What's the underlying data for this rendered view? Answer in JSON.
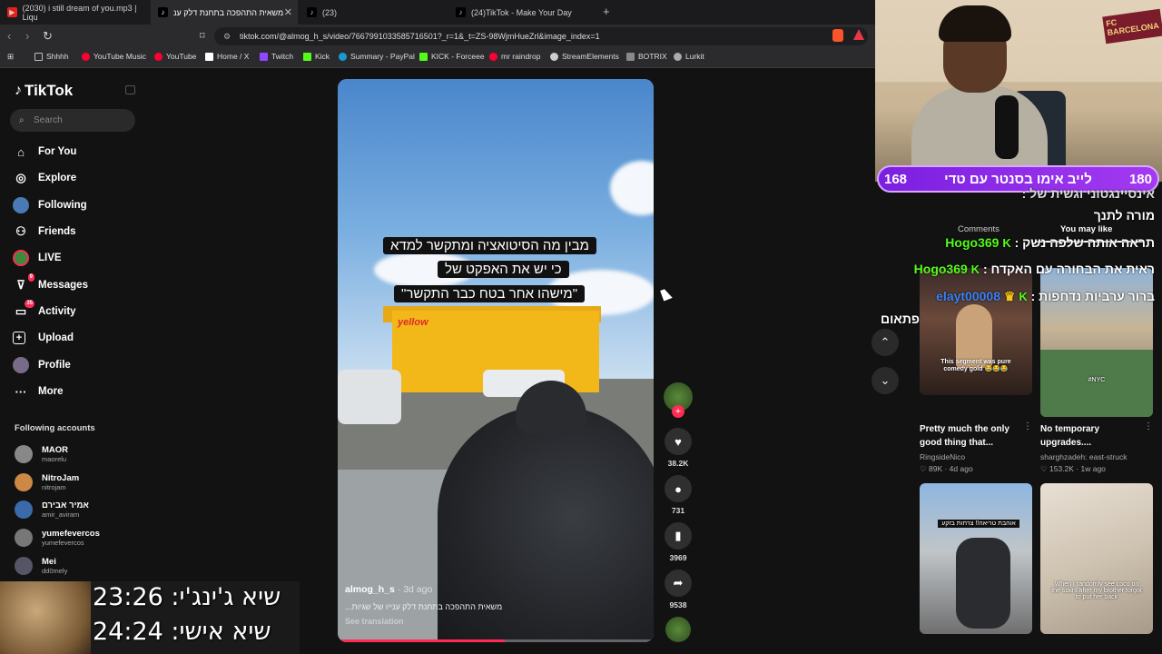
{
  "browser": {
    "tabs": [
      {
        "title": "(2030) i still dream of you.mp3 | Liqu"
      },
      {
        "title": "משאית התהפכה בתחנת דלק ענ"
      },
      {
        "title": "(23)"
      },
      {
        "title": "(24)TikTok - Make Your Day"
      }
    ],
    "url": "tiktok.com/@almog_h_s/video/7667991033585716501?_r=1&_t=ZS-98WjmHueZrl&image_index=1",
    "bookmarks": [
      "Shhhh",
      "YouTube Music",
      "YouTube",
      "Home / X",
      "Twitch",
      "Kick",
      "Summary - PayPal",
      "KICK - Forceee",
      "mr raindrop",
      "StreamElements",
      "BOTRIX",
      "Lurkit"
    ]
  },
  "sidebar": {
    "logo": "TikTok",
    "search_placeholder": "Search",
    "items": [
      {
        "label": "For You"
      },
      {
        "label": "Explore"
      },
      {
        "label": "Following"
      },
      {
        "label": "Friends"
      },
      {
        "label": "LIVE"
      },
      {
        "label": "Messages",
        "badge": "9"
      },
      {
        "label": "Activity",
        "badge": "35"
      },
      {
        "label": "Upload"
      },
      {
        "label": "Profile"
      },
      {
        "label": "More"
      }
    ],
    "following_title": "Following accounts",
    "accounts": [
      {
        "name": "MAOR",
        "handle": "maorelu"
      },
      {
        "name": "NitroJam",
        "handle": "nitrojam"
      },
      {
        "name": "אמיר אבירם",
        "handle": "amir_aviram"
      },
      {
        "name": "yumefevercos",
        "handle": "yumefevercos"
      },
      {
        "name": "Mei",
        "handle": "dd0mely"
      }
    ]
  },
  "video": {
    "caption_lines": [
      "מבין מה הסיטואציה ומתקשר למדא",
      "כי יש את האפקט של",
      "\"מישהו אחר בטח כבר התקשר\""
    ],
    "sign_text": "yellow",
    "author": "almog_h_s",
    "age": "· 3d ago",
    "description": "משאית התהפכה בתחנת דלק ענייו של שגיות...",
    "translation_label": "See translation",
    "progress": 0.53,
    "likes": "38.2K",
    "comments": "731",
    "saves": "3969",
    "shares": "9538"
  },
  "stream": {
    "left_count": "168",
    "right_count": "180",
    "title": "לייב אימו בסנטר עם טדי",
    "banner": "FC BARCELONA"
  },
  "panel": {
    "comments_tab": "Comments",
    "you_may_like_tab": "You may like"
  },
  "chat": [
    {
      "user": "",
      "text": "אינסיינגטוני וגשית של :"
    },
    {
      "user": "",
      "text": "מורה לתנך"
    },
    {
      "user": "Hogo369",
      "text": "תראה אותה שלפה נשק :"
    },
    {
      "user": "Hogo369",
      "text": "ראית את הבחורה עם האקדח :"
    },
    {
      "user": "elayt00008",
      "text": "ברור ערביות נדחפות :"
    },
    {
      "user": "",
      "text": "פתאום"
    }
  ],
  "cards": [
    {
      "title": "Pretty much the only good thing that...",
      "author": "RingsideNico",
      "likes": "89K",
      "age": "4d ago",
      "overlay": "This segment was pure comedy gold 😂😂😂"
    },
    {
      "title": "No temporary upgrades....",
      "author": "sharghzadeh: east-struck",
      "likes": "153.2K",
      "age": "1w ago",
      "overlay": "#NYC"
    },
    {
      "title": "",
      "author": "",
      "likes": "",
      "age": "",
      "overlay": "אוהבת טריאה!! צרחות בזקע"
    },
    {
      "title": "",
      "author": "",
      "likes": "",
      "age": "",
      "overlay": "When I randomly see coco on the stairs after my brother forgot to put her back"
    }
  ],
  "timers": [
    {
      "text": "שיא ג'ינג'י: 23:26"
    },
    {
      "text": "שיא אישי: 24:24"
    }
  ]
}
